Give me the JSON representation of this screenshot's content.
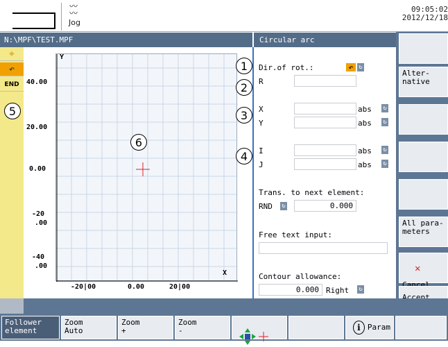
{
  "header": {
    "mode_label": "Jog",
    "clock_time": "09:05:02",
    "clock_date": "2012/12/18",
    "file_path": "N:\\MPF\\TEST.MPF",
    "dialog_title": "Circular arc"
  },
  "left_strip": {
    "icons": [
      "crosshair-icon",
      "arc-icon",
      "end-icon"
    ],
    "end_label": "END",
    "callout": "5"
  },
  "graph": {
    "y_axis_label": "Y",
    "x_axis_label": "X",
    "y_ticks": [
      "40.00",
      "20.00",
      "0.00",
      "-20",
      ".00",
      "-40",
      ".00"
    ],
    "x_ticks": [
      "-20|00",
      "0.00",
      "20|00"
    ],
    "callout": "6",
    "cursor_color": "#e0202a"
  },
  "form": {
    "dir_label": "Dir.of rot.:",
    "r_label": "R",
    "r_value": "",
    "x_label": "X",
    "x_value": "",
    "x_mode": "abs",
    "y_label": "Y",
    "y_value": "",
    "y_mode": "abs",
    "i_label": "I",
    "i_value": "",
    "i_mode": "abs",
    "j_label": "J",
    "j_value": "",
    "j_mode": "abs",
    "trans_label": "Trans. to next element:",
    "rnd_label": "RND",
    "rnd_value": "0.000",
    "free_text_label": "Free text input:",
    "free_text_value": "",
    "contour_label": "Contour allowance:",
    "contour_value": "0.000",
    "contour_side": "Right",
    "callouts": [
      "1",
      "2",
      "3",
      "4"
    ]
  },
  "softkeys": {
    "alternative": "Alter-\nnative",
    "all_parameters": "All para-\nmeters",
    "cancel": "Cancel",
    "accept": "Accept\nelement"
  },
  "bottom_keys": {
    "follower": "Follower\nelement",
    "zoom_auto": "Zoom\nAuto",
    "zoom_plus": "Zoom\n+",
    "zoom_minus": "Zoom\n-",
    "param": "Param"
  },
  "colors": {
    "header_bg": "#536c88",
    "softkey_bar": "#5d7693",
    "strip_yellow": "#f4e98a",
    "cancel_x": "#e0202a",
    "active_toggle": "#f0a000"
  }
}
